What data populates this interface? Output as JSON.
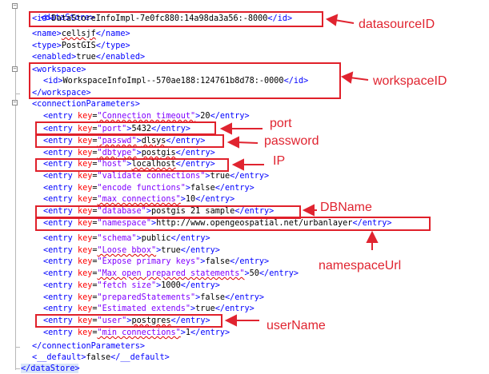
{
  "lines": {
    "l01_open": "<dataStore>",
    "l02_id_open": "<id>",
    "l02_id_val": "DataStoreInfoImpl-7e0fc880:14a98da3a56:-8000",
    "l02_id_close": "</id>",
    "l03_name_open": "<name>",
    "l03_name_val": "cellsjf",
    "l03_name_close": "</name>",
    "l04_type_open": "<type>",
    "l04_type_val": "PostGIS",
    "l04_type_close": "</type>",
    "l05_enabled_open": "<enabled>",
    "l05_enabled_val": "true",
    "l05_enabled_close": "</enabled>",
    "l06_ws_open": "<workspace>",
    "l07_id_open": "<id>",
    "l07_id_val": "WorkspaceInfoImpl--570ae188:124761b8d78:-0000",
    "l07_id_close": "</id>",
    "l08_ws_close": "</workspace>",
    "l09_cp_open": "<connectionParameters>",
    "entry_open_a": "<entry ",
    "entry_key_attr": "key",
    "entry_eq": "=",
    "entry_gt": ">",
    "entry_close": "</entry>",
    "l31_cp_close": "</connectionParameters>",
    "l32_default_open": "<__default>",
    "l32_default_val": "false",
    "l32_default_close": "</__default>",
    "l33_close": "</dataStore>"
  },
  "entries": [
    {
      "key": "\"Connection timeout\"",
      "val": "20"
    },
    {
      "key": "\"port\"",
      "val": "5432"
    },
    {
      "key": "\"passwd\"",
      "val": "dlsys"
    },
    {
      "key": "\"dbtype\"",
      "val": "postgis"
    },
    {
      "key": "\"host\"",
      "val": "localhost"
    },
    {
      "key": "\"validate connections\"",
      "val": "true"
    },
    {
      "key": "\"encode functions\"",
      "val": "false"
    },
    {
      "key": "\"max connections\"",
      "val": "10"
    },
    {
      "key": "\"database\"",
      "val": "postgis 21 sample"
    },
    {
      "key": "\"namespace\"",
      "val": "http://www.opengeospatial.net/urbanlayer"
    },
    {
      "key": "\"schema\"",
      "val": "public"
    },
    {
      "key": "\"Loose bbox\"",
      "val": "true"
    },
    {
      "key": "\"Expose primary keys\"",
      "val": "false"
    },
    {
      "key": "\"Max open prepared statements\"",
      "val": "50"
    },
    {
      "key": "\"fetch size\"",
      "val": "1000"
    },
    {
      "key": "\"preparedStatements\"",
      "val": "false"
    },
    {
      "key": "\"Estimated extends\"",
      "val": "true"
    },
    {
      "key": "\"user\"",
      "val": "postgres"
    },
    {
      "key": "\"min connections\"",
      "val": "1"
    }
  ],
  "annotations": {
    "datasourceID": "datasourceID",
    "workspaceID": "workspaceID",
    "port": "port",
    "password": "password",
    "ip": "IP",
    "dbname": "DBName",
    "namespaceUrl": "namespaceUrl",
    "userName": "userName"
  },
  "colors": {
    "tag": "#0000ff",
    "attr": "#ff0000",
    "attr_value": "#8000ff",
    "annotation": "#e02430"
  }
}
